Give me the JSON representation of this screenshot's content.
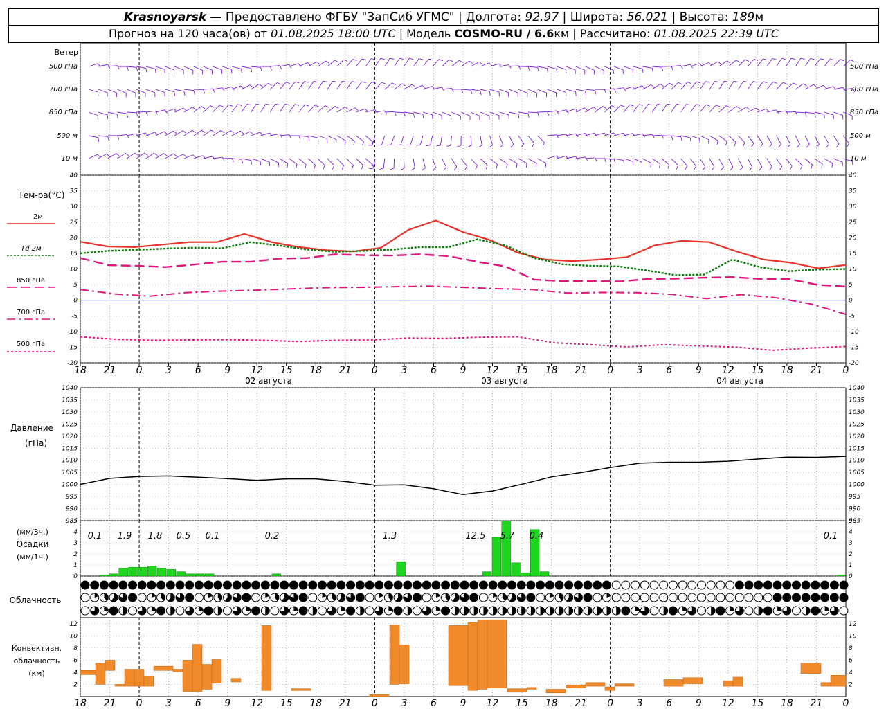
{
  "header": {
    "city": "Krasnoyarsk",
    "provider": " — Предоставлено ФГБУ \"ЗапСиб УГМС\" | Долгота: ",
    "lon": "92.97",
    "lat_label": " | Широта: ",
    "lat": "56.021",
    "alt_label": " | Высота: ",
    "alt": "189",
    "alt_unit": "м",
    "fc_label": "Прогноз на 120 часа(ов) от ",
    "fc_time": "01.08.2025 18:00 UTC",
    "model_label": " | Модель ",
    "model": "COSMO-RU / 6.6",
    "model_unit": "км",
    "calc_label": " | Рассчитано: ",
    "calc_time": "01.08.2025 22:39 UTC"
  },
  "labels": {
    "wind": "Ветер",
    "wind_levels": [
      "500 гПа",
      "700 гПа",
      "850 гПа",
      "500 м",
      "10  м"
    ],
    "temp": "Тем-ра(°С)",
    "leg_2m": "2м",
    "leg_td": "Td  2м",
    "leg_850": "850 гПа",
    "leg_700": "700 гПа",
    "leg_500": "500 гПа",
    "pressure": "Давление",
    "pressure_unit": "(гПа)",
    "precip_unit3": "(мм/3ч.)",
    "precip": "Осадки",
    "precip_unit1": "(мм/1ч.)",
    "clouds": "Облачность",
    "conv1": "Конвективн.",
    "conv2": "облачность",
    "conv3": "(км)",
    "day1": "02 августа",
    "day2": "03 августа",
    "day3": "04 августа"
  },
  "colors": {
    "t2m": "#e8322a",
    "td": "#0a7d0a",
    "t850": "#e0167a",
    "wind": "#7a1fd6",
    "precip": "#1fd61f",
    "conv": "#f08a2a",
    "zero": "#2020c0"
  },
  "chart_data": [
    {
      "type": "line",
      "name": "temperature",
      "x_ticks": [
        "18",
        "21",
        "0",
        "3",
        "6",
        "9",
        "12",
        "15",
        "18",
        "21",
        "0",
        "3",
        "6",
        "9",
        "12",
        "15",
        "18",
        "21",
        "0",
        "3",
        "6",
        "9",
        "12",
        "15",
        "18",
        "21",
        "0"
      ],
      "ylim": [
        -20,
        40
      ],
      "y_ticks": [
        40,
        35,
        30,
        25,
        20,
        15,
        10,
        5,
        0,
        -5,
        -10,
        -15,
        -20
      ],
      "hours": [
        0,
        3,
        6,
        9,
        12,
        15,
        18,
        21,
        24,
        27,
        30,
        33,
        36,
        39,
        42,
        45,
        48,
        51,
        54,
        57,
        60,
        63,
        66,
        69,
        72,
        75,
        78
      ],
      "series": [
        {
          "name": "2м",
          "values": [
            18.7,
            17.2,
            17,
            17.8,
            18.6,
            18.6,
            21.2,
            18.6,
            17,
            16,
            15.6,
            16.8,
            22.5,
            25.5,
            21.8,
            19.2,
            15.2,
            13,
            12.5,
            13,
            13.8,
            17.5,
            19,
            18.6,
            15.6,
            13,
            12,
            10.2,
            11.3
          ]
        },
        {
          "name": "Td  2м",
          "values": [
            15,
            15.8,
            16.1,
            16.5,
            16.8,
            16.6,
            18.6,
            17.5,
            16.2,
            15.5,
            15.8,
            16.2,
            17,
            17,
            19.5,
            17.5,
            13.5,
            11.5,
            11,
            10.8,
            9.5,
            8,
            8.2,
            13,
            10.5,
            9.3,
            9.8,
            10
          ]
        },
        {
          "name": "850 гПа",
          "values": [
            13.5,
            11.2,
            11,
            10.6,
            11.4,
            12.3,
            12.3,
            13.3,
            13.5,
            14.7,
            14.4,
            14.3,
            14.7,
            14.1,
            12.3,
            10.8,
            6.6,
            6.1,
            6.2,
            6,
            6.8,
            6.9,
            7.2,
            7.4,
            6.8,
            6.8,
            4.9,
            4.4
          ]
        },
        {
          "name": "700 гПа",
          "values": [
            3.4,
            2,
            1.3,
            2.4,
            2.9,
            3.2,
            3.6,
            4,
            4.1,
            4.3,
            4.5,
            4.1,
            3.7,
            3.4,
            2.3,
            2.5,
            2.4,
            1.9,
            0.5,
            1.8,
            0.8,
            -1.2,
            -4.5
          ]
        },
        {
          "name": "500 гПа",
          "values": [
            -11.7,
            -12.5,
            -12.8,
            -12.7,
            -12.6,
            -12.8,
            -13.2,
            -12.8,
            -12.7,
            -12.1,
            -12.2,
            -11.8,
            -11.7,
            -13.6,
            -14.2,
            -14.9,
            -14.2,
            -14.6,
            -15,
            -16,
            -15.3,
            -14.8
          ]
        }
      ]
    },
    {
      "type": "line",
      "name": "pressure",
      "ylim": [
        985,
        1040
      ],
      "y_ticks": [
        1040,
        1035,
        1030,
        1025,
        1020,
        1015,
        1010,
        1005,
        1000,
        995,
        990,
        985
      ],
      "series": [
        {
          "name": "Давление",
          "values": [
            1000,
            1002.5,
            1003.3,
            1003.5,
            1003,
            1002.4,
            1001.7,
            1002.3,
            1002.3,
            1001.2,
            999.7,
            999.8,
            998.2,
            995.8,
            997.3,
            1000.1,
            1003.1,
            1004.9,
            1007,
            1008.8,
            1009.2,
            1009.2,
            1009.6,
            1010.5,
            1011.3,
            1011.2,
            1011.6
          ]
        }
      ]
    },
    {
      "type": "bar",
      "name": "precipitation",
      "ylim": [
        0,
        5
      ],
      "y_ticks": [
        5,
        4,
        3,
        2,
        1,
        0
      ],
      "annotations_3h": [
        "0.1",
        "1.9",
        "1.8",
        "0.5",
        "0.1",
        "0.2",
        "1.3",
        "12.5",
        "5.7",
        "0.4",
        "0.1"
      ],
      "values_1h": [
        0,
        0,
        0.1,
        0.2,
        0.7,
        0.8,
        0.8,
        0.9,
        0.7,
        0.6,
        0.4,
        0.2,
        0.2,
        0.2,
        0,
        0,
        0,
        0,
        0,
        0,
        0.2,
        0,
        0,
        0,
        0,
        0,
        0,
        0,
        0,
        0,
        0,
        0,
        0,
        1.3,
        0,
        0,
        0,
        0,
        0,
        0,
        0,
        0,
        0.4,
        3.5,
        5.9,
        1.2,
        0.3,
        4.2,
        0.4,
        0,
        0,
        0,
        0,
        0,
        0,
        0,
        0,
        0,
        0,
        0,
        0,
        0,
        0,
        0,
        0,
        0,
        0,
        0,
        0,
        0,
        0,
        0,
        0,
        0,
        0,
        0,
        0,
        0,
        0,
        0.1
      ]
    },
    {
      "type": "bar",
      "name": "convective_clouds",
      "ylim": [
        0,
        13
      ],
      "y_ticks": [
        12,
        10,
        8,
        6,
        4,
        2
      ],
      "bars": [
        [
          4.3,
          3.6
        ],
        [
          5.5,
          2
        ],
        [
          6,
          4.3
        ],
        [
          2,
          1.7
        ],
        [
          4.5,
          1.7
        ],
        [
          4.5,
          1.7
        ],
        [
          3.4,
          1.7
        ],
        [
          5,
          4.3
        ],
        [
          4.5,
          4.1
        ],
        [
          6,
          0.8
        ],
        [
          8.6,
          0.8
        ],
        [
          5.3,
          1.2
        ],
        [
          6.1,
          2.2
        ],
        [
          3,
          2.4
        ],
        [
          11.7,
          1
        ],
        [
          1.3,
          1
        ],
        [
          0.3,
          0
        ],
        [
          11.8,
          2
        ],
        [
          8.5,
          2.1
        ],
        [
          11.7,
          1.8
        ],
        [
          12.2,
          1
        ],
        [
          12.6,
          1.2
        ],
        [
          12.6,
          1.4
        ],
        [
          1.3,
          0.7
        ],
        [
          1.5,
          1.2
        ],
        [
          1.2,
          0.6
        ],
        [
          1.9,
          1.4
        ],
        [
          2.3,
          1.7
        ],
        [
          1.6,
          1
        ],
        [
          2.1,
          1.7
        ],
        [
          2.8,
          1.7
        ],
        [
          3.1,
          2.1
        ],
        [
          2.6,
          1.7
        ],
        [
          3.2,
          1.7
        ],
        [
          5.5,
          3.8
        ],
        [
          2.3,
          1.7
        ],
        [
          3.5,
          1.7
        ]
      ]
    }
  ]
}
